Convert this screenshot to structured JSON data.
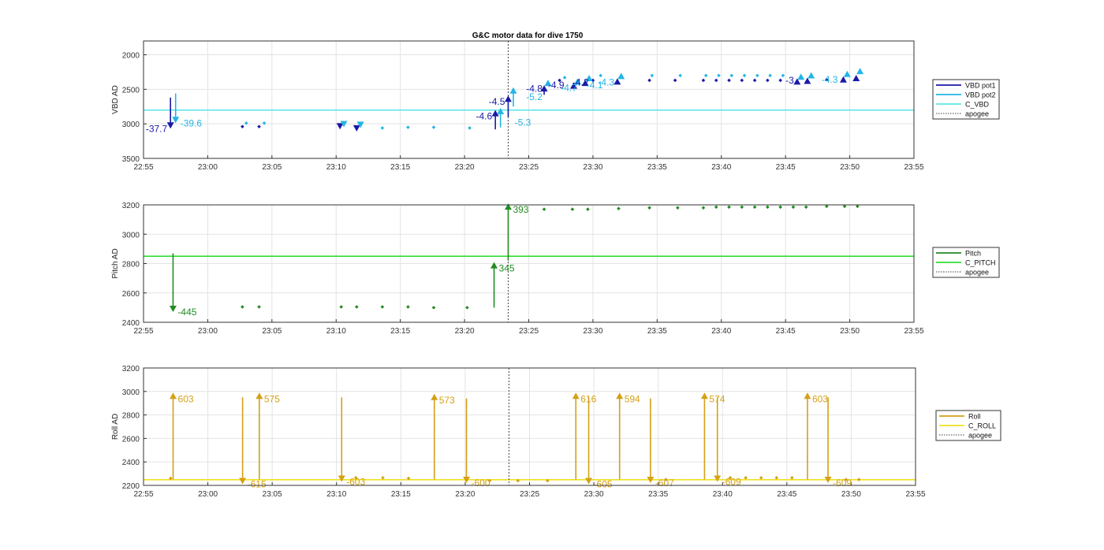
{
  "figure_title": "G&C motor data for dive 1750",
  "chart_data": [
    {
      "type": "scatter",
      "id": "vbd",
      "title": "G&C motor data for dive 1750",
      "ylabel": "VBD AD",
      "ylim": [
        1800,
        3500
      ],
      "y_reversed": true,
      "yticks": [
        "2000",
        "2500",
        "3000",
        "3500"
      ],
      "xlim": [
        "22:55",
        "23:55"
      ],
      "xticks": [
        "22:55",
        "23:00",
        "23:05",
        "23:10",
        "23:15",
        "23:20",
        "23:25",
        "23:30",
        "23:35",
        "23:40",
        "23:45",
        "23:50",
        "23:55"
      ],
      "grid": true,
      "legend": {
        "placement": "outside-right",
        "entries": [
          {
            "label": "VBD pot1",
            "color": "#1a1aa8",
            "style": "solid"
          },
          {
            "label": "VBD pot2",
            "color": "#23b5e6",
            "style": "solid"
          },
          {
            "label": "C_VBD",
            "color": "#5ee6e6",
            "style": "solid"
          },
          {
            "label": "apogee",
            "color": "#444444",
            "style": "dotted"
          }
        ]
      },
      "reference_line": {
        "name": "C_VBD",
        "y": 2800,
        "color": "#5ee6e6"
      },
      "apogee_x": "23:23.4",
      "series": [
        {
          "name": "VBD pot1",
          "color": "#1a1aa8",
          "points": [
            [
              "23:02.7",
              3040
            ],
            [
              "23:04.0",
              3040
            ],
            [
              "23:27.4",
              2370
            ],
            [
              "23:30.0",
              2370
            ],
            [
              "23:34.4",
              2370
            ],
            [
              "23:36.4",
              2370
            ],
            [
              "23:38.6",
              2370
            ],
            [
              "23:39.6",
              2370
            ],
            [
              "23:40.6",
              2370
            ],
            [
              "23:41.6",
              2370
            ],
            [
              "23:42.6",
              2370
            ],
            [
              "23:43.6",
              2370
            ],
            [
              "23:44.6",
              2370
            ],
            [
              "23:48.2",
              2360
            ]
          ]
        },
        {
          "name": "VBD pot2",
          "color": "#23b5e6",
          "points": [
            [
              "23:03.0",
              2990
            ],
            [
              "23:04.4",
              2990
            ],
            [
              "23:13.6",
              3060
            ],
            [
              "23:15.6",
              3050
            ],
            [
              "23:17.6",
              3050
            ],
            [
              "23:20.4",
              3060
            ],
            [
              "23:27.8",
              2330
            ],
            [
              "23:30.6",
              2300
            ],
            [
              "23:34.6",
              2300
            ],
            [
              "23:36.8",
              2300
            ],
            [
              "23:38.8",
              2300
            ],
            [
              "23:39.8",
              2300
            ],
            [
              "23:40.8",
              2300
            ],
            [
              "23:41.8",
              2300
            ],
            [
              "23:42.8",
              2300
            ],
            [
              "23:43.8",
              2300
            ],
            [
              "23:44.8",
              2300
            ]
          ]
        }
      ],
      "arrows": [
        {
          "x": "22:57.1",
          "from": 2620,
          "to": 3070,
          "color": "#1a1aa8",
          "label": "-37.7",
          "label_side": "left"
        },
        {
          "x": "22:57.5",
          "from": 2560,
          "to": 2990,
          "color": "#23b5e6",
          "label": "-39.6",
          "label_side": "right"
        },
        {
          "x": "23:10.3",
          "from": 3000,
          "to": 3080,
          "color": "#1a1aa8"
        },
        {
          "x": "23:10.6",
          "from": 2980,
          "to": 3050,
          "color": "#23b5e6"
        },
        {
          "x": "23:11.6",
          "from": 3050,
          "to": 3110,
          "color": "#1a1aa8"
        },
        {
          "x": "23:11.9",
          "from": 3000,
          "to": 3060,
          "color": "#23b5e6"
        },
        {
          "x": "23:22.4",
          "from": 3080,
          "to": 2800,
          "color": "#1a1aa8",
          "label": "-4.6",
          "label_side": "left"
        },
        {
          "x": "23:22.8",
          "from": 3050,
          "to": 2770,
          "color": "#23b5e6"
        },
        {
          "x": "23:23.4",
          "from": 2900,
          "to": 2590,
          "color": "#1a1aa8",
          "label": "-4.5",
          "label_side": "left"
        },
        {
          "x": "23:23.8",
          "from": 2750,
          "to": 2470,
          "color": "#23b5e6"
        },
        {
          "x": "23:26.2",
          "from": 2580,
          "to": 2440,
          "color": "#1a1aa8"
        },
        {
          "x": "23:26.5",
          "from": 2450,
          "to": 2360,
          "color": "#23b5e6"
        },
        {
          "x": "23:28.5",
          "from": 2460,
          "to": 2400,
          "color": "#1a1aa8"
        },
        {
          "x": "23:28.8",
          "from": 2390,
          "to": 2340,
          "color": "#23b5e6"
        },
        {
          "x": "23:29.4",
          "from": 2420,
          "to": 2360,
          "color": "#1a1aa8"
        },
        {
          "x": "23:29.7",
          "from": 2340,
          "to": 2290,
          "color": "#23b5e6"
        },
        {
          "x": "23:31.9",
          "from": 2400,
          "to": 2340,
          "color": "#1a1aa8"
        },
        {
          "x": "23:32.2",
          "from": 2320,
          "to": 2260,
          "color": "#23b5e6"
        },
        {
          "x": "23:45.9",
          "from": 2400,
          "to": 2340,
          "color": "#1a1aa8"
        },
        {
          "x": "23:46.2",
          "from": 2330,
          "to": 2270,
          "color": "#23b5e6"
        },
        {
          "x": "23:46.7",
          "from": 2390,
          "to": 2330,
          "color": "#1a1aa8"
        },
        {
          "x": "23:47.0",
          "from": 2310,
          "to": 2250,
          "color": "#23b5e6"
        },
        {
          "x": "23:49.5",
          "from": 2370,
          "to": 2310,
          "color": "#1a1aa8"
        },
        {
          "x": "23:49.8",
          "from": 2290,
          "to": 2230,
          "color": "#23b5e6"
        },
        {
          "x": "23:50.5",
          "from": 2350,
          "to": 2290,
          "color": "#1a1aa8"
        },
        {
          "x": "23:50.8",
          "from": 2250,
          "to": 2190,
          "color": "#23b5e6"
        }
      ],
      "labels": [
        {
          "x": "23:23.9",
          "y": 2980,
          "text": "-5.3",
          "color": "#23b5e6"
        },
        {
          "x": "23:24.8",
          "y": 2490,
          "text": "-4.8",
          "color": "#1a1aa8"
        },
        {
          "x": "23:24.8",
          "y": 2610,
          "text": "-5.2",
          "color": "#23b5e6"
        },
        {
          "x": "23:26.5",
          "y": 2440,
          "text": "-4.9",
          "color": "#1a1aa8"
        },
        {
          "x": "23:27.5",
          "y": 2480,
          "text": "-4.7",
          "color": "#23b5e6"
        },
        {
          "x": "23:28.4",
          "y": 2400,
          "text": "-4.2",
          "color": "#1a1aa8"
        },
        {
          "x": "23:29.5",
          "y": 2440,
          "text": "-4.1",
          "color": "#23b5e6"
        },
        {
          "x": "23:30.4",
          "y": 2400,
          "text": "-4.3",
          "color": "#23b5e6"
        },
        {
          "x": "23:45.0",
          "y": 2370,
          "text": "-3",
          "color": "#1a1aa8"
        },
        {
          "x": "23:47.8",
          "y": 2360,
          "text": "-4.3",
          "color": "#23b5e6"
        }
      ]
    },
    {
      "type": "scatter",
      "id": "pitch",
      "ylabel": "Pitch AD",
      "ylim": [
        2400,
        3200
      ],
      "y_reversed": false,
      "yticks": [
        "2400",
        "2600",
        "2800",
        "3000",
        "3200"
      ],
      "xlim": [
        "22:55",
        "23:55"
      ],
      "xticks": [
        "22:55",
        "23:00",
        "23:05",
        "23:10",
        "23:15",
        "23:20",
        "23:25",
        "23:30",
        "23:35",
        "23:40",
        "23:45",
        "23:50",
        "23:55"
      ],
      "grid": true,
      "legend": {
        "placement": "outside-right",
        "entries": [
          {
            "label": "Pitch",
            "color": "#228b22",
            "style": "solid"
          },
          {
            "label": "C_PITCH",
            "color": "#33dd33",
            "style": "solid"
          },
          {
            "label": "apogee",
            "color": "#444444",
            "style": "dotted"
          }
        ]
      },
      "reference_line": {
        "name": "C_PITCH",
        "y": 2850,
        "color": "#33dd33"
      },
      "apogee_x": "23:23.4",
      "series": [
        {
          "name": "Pitch",
          "color": "#228b22",
          "points": [
            [
              "23:02.7",
              2505
            ],
            [
              "23:04.0",
              2505
            ],
            [
              "23:10.4",
              2505
            ],
            [
              "23:11.6",
              2505
            ],
            [
              "23:13.6",
              2505
            ],
            [
              "23:15.6",
              2505
            ],
            [
              "23:17.6",
              2500
            ],
            [
              "23:20.2",
              2500
            ],
            [
              "23:26.2",
              3170
            ],
            [
              "23:28.4",
              3170
            ],
            [
              "23:29.6",
              3170
            ],
            [
              "23:32.0",
              3175
            ],
            [
              "23:34.4",
              3180
            ],
            [
              "23:36.6",
              3180
            ],
            [
              "23:38.6",
              3180
            ],
            [
              "23:39.6",
              3185
            ],
            [
              "23:40.6",
              3185
            ],
            [
              "23:41.6",
              3185
            ],
            [
              "23:42.6",
              3185
            ],
            [
              "23:43.6",
              3185
            ],
            [
              "23:44.6",
              3185
            ],
            [
              "23:45.6",
              3185
            ],
            [
              "23:46.6",
              3185
            ],
            [
              "23:48.2",
              3190
            ],
            [
              "23:49.6",
              3190
            ],
            [
              "23:50.6",
              3190
            ]
          ]
        }
      ],
      "arrows": [
        {
          "x": "22:57.3",
          "from": 2870,
          "to": 2470,
          "color": "#228b22",
          "label": "-445",
          "label_side": "right"
        },
        {
          "x": "23:22.3",
          "from": 2500,
          "to": 2810,
          "color": "#228b22",
          "label": "345",
          "label_side": "right"
        },
        {
          "x": "23:23.4",
          "from": 2820,
          "to": 3210,
          "color": "#228b22",
          "label": "393",
          "label_side": "right"
        }
      ],
      "labels": []
    },
    {
      "type": "scatter",
      "id": "roll",
      "ylabel": "Roll AD",
      "ylim": [
        2200,
        3200
      ],
      "y_reversed": false,
      "yticks": [
        "2200",
        "2400",
        "2600",
        "2800",
        "3000",
        "3200"
      ],
      "xlim": [
        "22:55",
        "23:55"
      ],
      "xticks": [
        "22:55",
        "23:00",
        "23:05",
        "23:10",
        "23:15",
        "23:20",
        "23:25",
        "23:30",
        "23:35",
        "23:40",
        "23:45",
        "23:50",
        "23:55"
      ],
      "grid": true,
      "legend": {
        "placement": "outside-right",
        "entries": [
          {
            "label": "Roll",
            "color": "#d4a017",
            "style": "solid"
          },
          {
            "label": "C_ROLL",
            "color": "#f0e020",
            "style": "solid"
          },
          {
            "label": "apogee",
            "color": "#444444",
            "style": "dotted"
          }
        ]
      },
      "reference_line": {
        "name": "C_ROLL",
        "y": 2248,
        "color": "#f0e020"
      },
      "apogee_x": "23:23.4",
      "series": [
        {
          "name": "Roll",
          "color": "#d4a017",
          "points": [
            [
              "22:57.1",
              2260
            ],
            [
              "23:11.5",
              2265
            ],
            [
              "23:13.6",
              2265
            ],
            [
              "23:15.6",
              2260
            ],
            [
              "23:21.9",
              2240
            ],
            [
              "23:24.1",
              2240
            ],
            [
              "23:26.4",
              2240
            ],
            [
              "23:35.6",
              2250
            ],
            [
              "23:40.6",
              2265
            ],
            [
              "23:41.8",
              2265
            ],
            [
              "23:43.0",
              2265
            ],
            [
              "23:44.2",
              2265
            ],
            [
              "23:45.4",
              2265
            ],
            [
              "23:49.6",
              2250
            ],
            [
              "23:50.6",
              2250
            ]
          ]
        }
      ],
      "arrows": [
        {
          "x": "22:57.3",
          "from": 2250,
          "to": 2990,
          "color": "#d4a017",
          "label": "603",
          "label_side": "right"
        },
        {
          "x": "23:02.7",
          "from": 2950,
          "to": 2210,
          "color": "#d4a017",
          "label": "-615",
          "label_side": "right"
        },
        {
          "x": "23:04.0",
          "from": 2250,
          "to": 2990,
          "color": "#d4a017",
          "label": "575",
          "label_side": "right"
        },
        {
          "x": "23:10.4",
          "from": 2950,
          "to": 2230,
          "color": "#d4a017",
          "label": "-603",
          "label_side": "right"
        },
        {
          "x": "23:17.6",
          "from": 2250,
          "to": 2980,
          "color": "#d4a017",
          "label": "573",
          "label_side": "right"
        },
        {
          "x": "23:20.1",
          "from": 2940,
          "to": 2220,
          "color": "#d4a017",
          "label": "-600",
          "label_side": "right"
        },
        {
          "x": "23:28.6",
          "from": 2250,
          "to": 2990,
          "color": "#d4a017",
          "label": "616",
          "label_side": "right"
        },
        {
          "x": "23:29.6",
          "from": 2950,
          "to": 2210,
          "color": "#d4a017",
          "label": "-605",
          "label_side": "right"
        },
        {
          "x": "23:32.0",
          "from": 2250,
          "to": 2990,
          "color": "#d4a017",
          "label": "594",
          "label_side": "right"
        },
        {
          "x": "23:34.4",
          "from": 2940,
          "to": 2220,
          "color": "#d4a017",
          "label": "-607",
          "label_side": "right"
        },
        {
          "x": "23:38.6",
          "from": 2250,
          "to": 2990,
          "color": "#d4a017",
          "label": "574",
          "label_side": "right"
        },
        {
          "x": "23:39.6",
          "from": 2950,
          "to": 2230,
          "color": "#d4a017",
          "label": "-609",
          "label_side": "right"
        },
        {
          "x": "23:46.6",
          "from": 2250,
          "to": 2990,
          "color": "#d4a017",
          "label": "603",
          "label_side": "right"
        },
        {
          "x": "23:48.2",
          "from": 2950,
          "to": 2220,
          "color": "#d4a017",
          "label": "-609",
          "label_side": "right"
        }
      ],
      "labels": []
    }
  ]
}
